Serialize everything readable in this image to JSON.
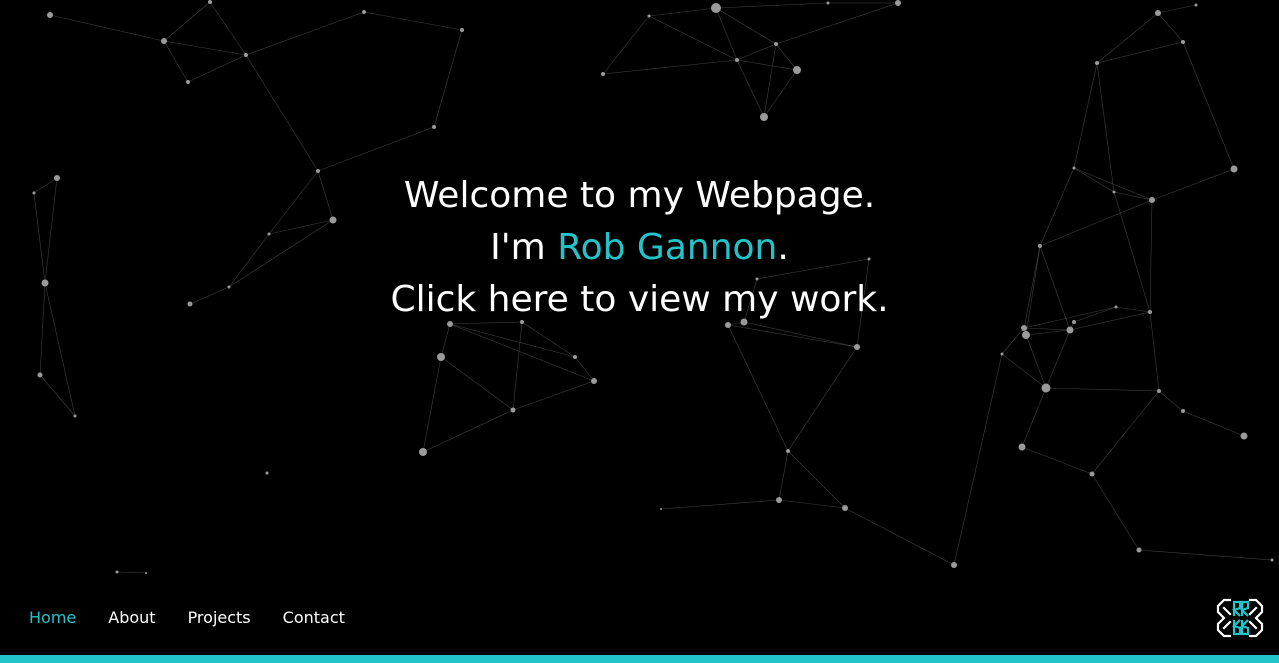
{
  "hero": {
    "line1": "Welcome to my Webpage.",
    "line2_prefix": "I'm ",
    "line2_name": "Rob Gannon",
    "line2_suffix": ".",
    "line3": "Click here to view my work."
  },
  "nav": {
    "items": [
      {
        "label": "Home",
        "active": true
      },
      {
        "label": "About",
        "active": false
      },
      {
        "label": "Projects",
        "active": false
      },
      {
        "label": "Contact",
        "active": false
      }
    ]
  },
  "logo": {
    "icon": "rg-monogram-logo-icon"
  },
  "background": {
    "icon": "particle-network-background"
  },
  "colors": {
    "accent": "#23c4c9",
    "background": "#000000",
    "text": "#ffffff",
    "network": "#9a9a9a"
  }
}
